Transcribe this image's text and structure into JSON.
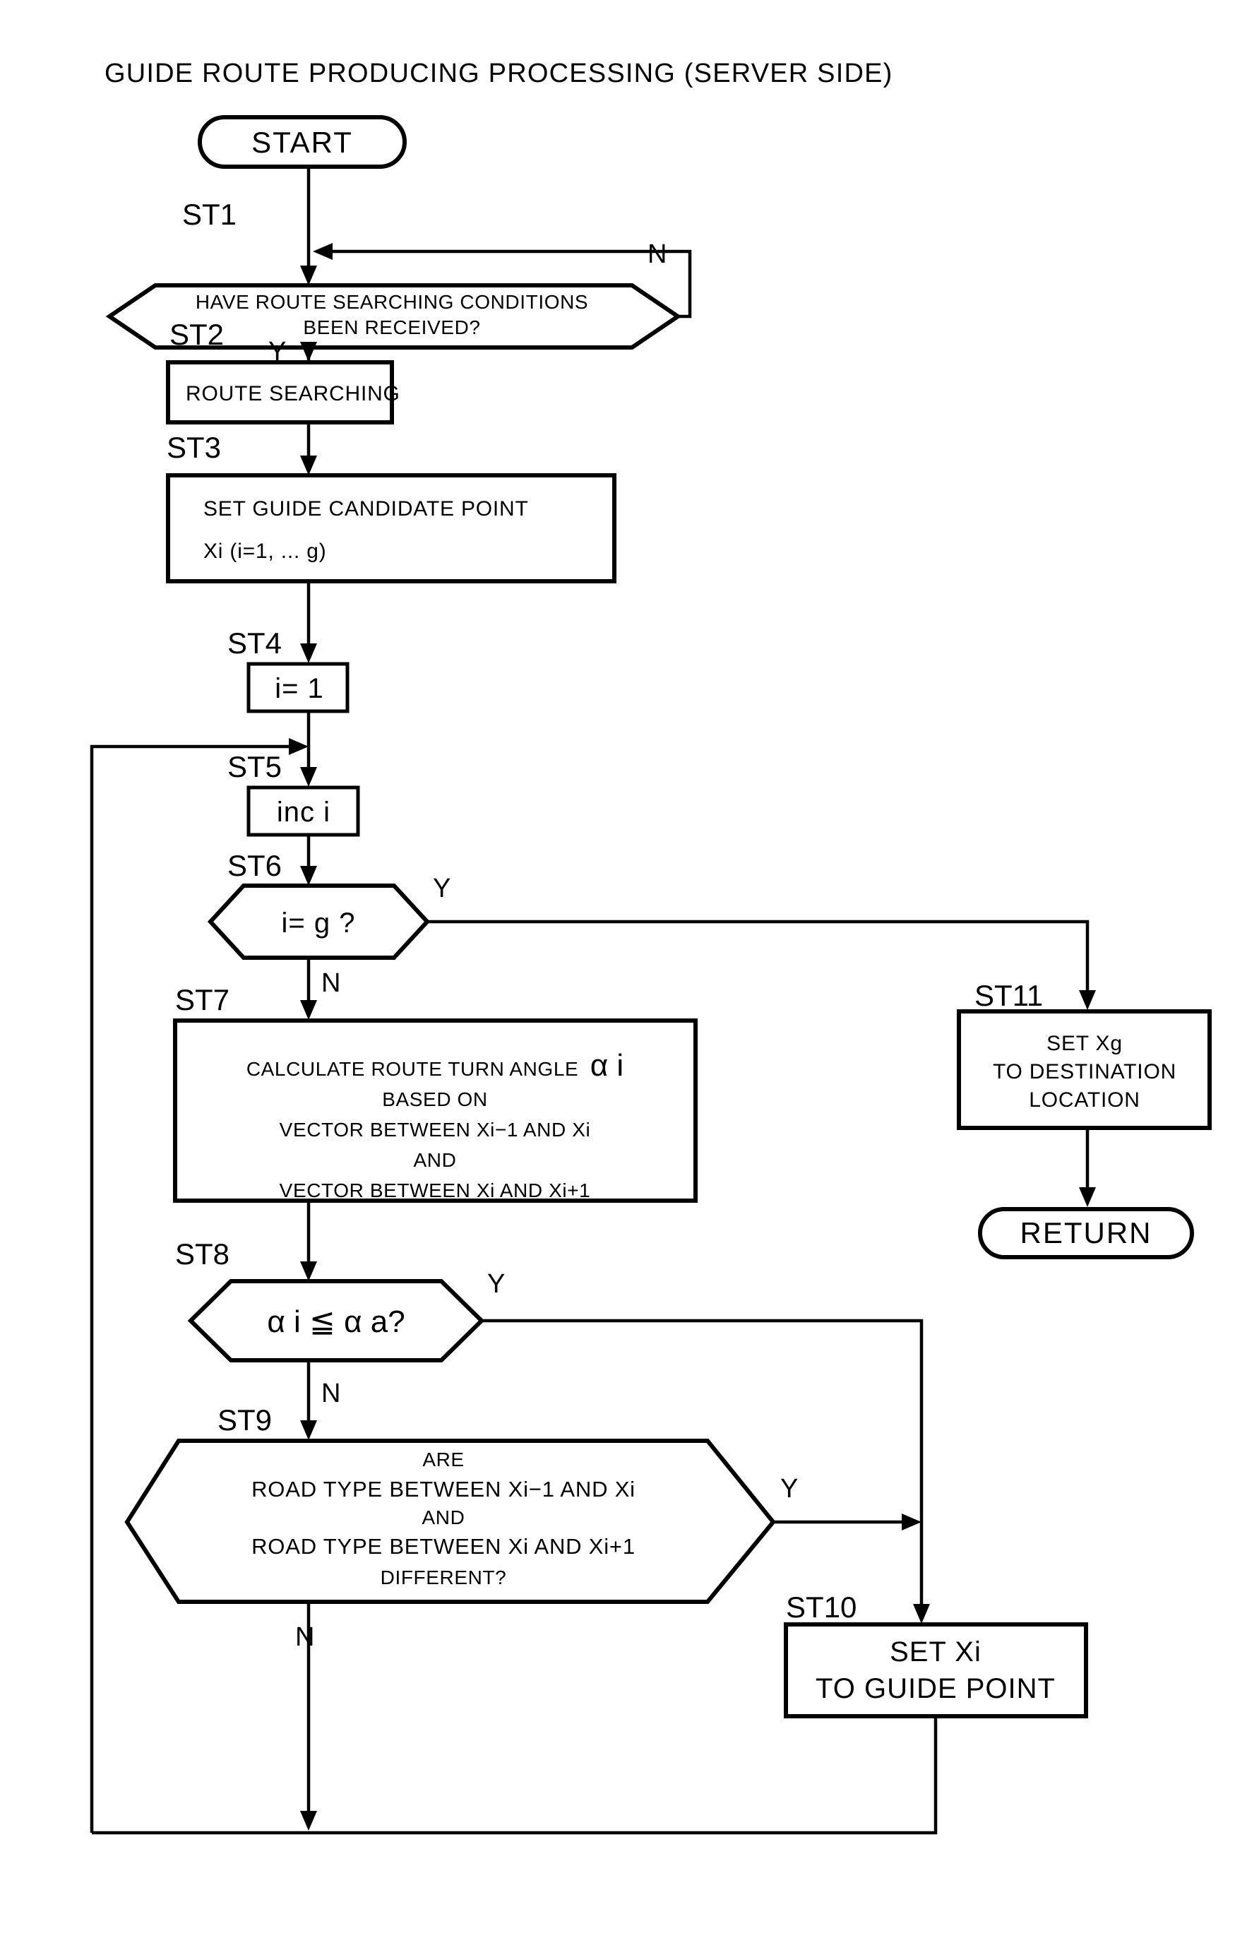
{
  "figure": {
    "title": "GUIDE ROUTE PRODUCING PROCESSING (SERVER SIDE)",
    "type": "flowchart",
    "ink_color": "#000000",
    "background_color": "#ffffff"
  },
  "nodes": {
    "start": {
      "shape": "terminator",
      "label": "START"
    },
    "st1": {
      "step": "ST1",
      "shape": "decision-hexagon",
      "line1": "HAVE ROUTE SEARCHING CONDITIONS",
      "line2": "BEEN RECEIVED?",
      "yes": "Y",
      "no": "N"
    },
    "st2": {
      "step": "ST2",
      "shape": "process-box",
      "label": "ROUTE SEARCHING"
    },
    "st3": {
      "step": "ST3",
      "shape": "process-box",
      "line1": "SET GUIDE CANDIDATE POINT",
      "line2": "Xi (i=1, ... g)"
    },
    "st4": {
      "step": "ST4",
      "shape": "process-box",
      "label": "i= 1"
    },
    "st5": {
      "step": "ST5",
      "shape": "process-box",
      "label": "inc i"
    },
    "st6": {
      "step": "ST6",
      "shape": "decision-hexagon",
      "label": "i= g ?",
      "yes": "Y",
      "no": "N"
    },
    "st7": {
      "step": "ST7",
      "shape": "process-box",
      "line1": "CALCULATE ROUTE TURN ANGLE",
      "line1_symbol": "α i",
      "line2": "BASED ON",
      "line3": "VECTOR BETWEEN Xi−1 AND Xi",
      "line4": "AND",
      "line5": "VECTOR BETWEEN Xi AND Xi+1"
    },
    "st8": {
      "step": "ST8",
      "shape": "decision-hexagon",
      "label": "α i ≦ α a?",
      "yes": "Y",
      "no": "N"
    },
    "st9": {
      "step": "ST9",
      "shape": "decision-hexagon",
      "line1": "ARE",
      "line2": "ROAD TYPE BETWEEN Xi−1 AND Xi",
      "line3": "AND",
      "line4": "ROAD TYPE BETWEEN Xi AND Xi+1",
      "line5": "DIFFERENT?",
      "yes": "Y",
      "no": "N"
    },
    "st10": {
      "step": "ST10",
      "shape": "process-box",
      "line1": "SET Xi",
      "line2": "TO GUIDE POINT"
    },
    "st11": {
      "step": "ST11",
      "shape": "process-box",
      "line1": "SET Xg",
      "line2": "TO DESTINATION",
      "line3": "LOCATION"
    },
    "return": {
      "shape": "terminator",
      "label": "RETURN"
    }
  },
  "edge_labels": {
    "st1_no": "N",
    "st1_yes": "Y",
    "st6_yes": "Y",
    "st6_no": "N",
    "st8_yes": "Y",
    "st8_no": "N",
    "st9_yes": "Y",
    "st9_no": "N"
  }
}
